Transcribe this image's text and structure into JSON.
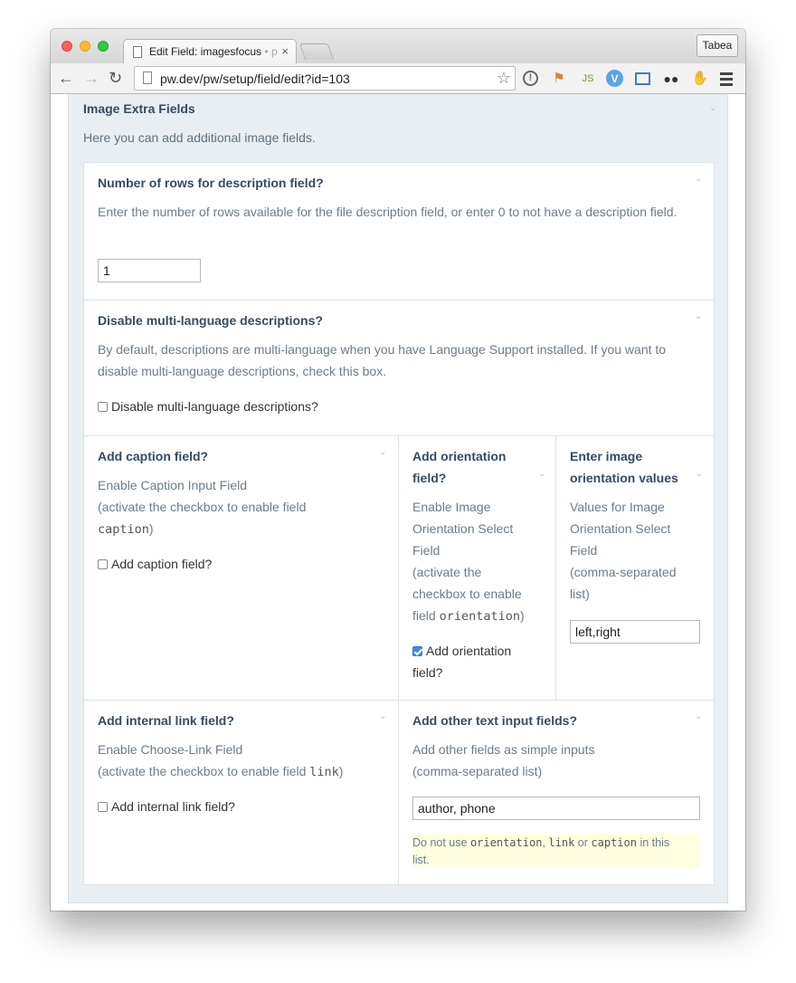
{
  "browser": {
    "tab_title": "Edit Field: imagesfocus",
    "tab_title_fade": "• p",
    "tab_close": "×",
    "user_button": "Tabea",
    "url": "pw.dev/pw/setup/field/edit?id=103",
    "icons": {
      "back": "←",
      "forward": "→",
      "reload": "↻",
      "star": "☆"
    }
  },
  "fieldset": {
    "title": "Image Extra Fields",
    "description": "Here you can add additional image fields."
  },
  "rows_field": {
    "label": "Number of rows for description field?",
    "description": "Enter the number of rows available for the file description field, or enter 0 to not have a description field.",
    "value": "1"
  },
  "multilang_field": {
    "label": "Disable multi-language descriptions?",
    "description": "By default, descriptions are multi-language when you have Language Support installed. If you want to disable multi-language descriptions, check this box.",
    "checkbox_label": "Disable multi-language descriptions?",
    "checked": false
  },
  "caption_field": {
    "label": "Add caption field?",
    "desc_line1": "Enable Caption Input Field",
    "desc_line2": "(activate the checkbox to enable field",
    "code": "caption",
    "desc_end": ")",
    "checkbox_label": "Add caption field?",
    "checked": false
  },
  "orientation_field": {
    "label_line1": "Add orientation",
    "label_line2": "field?",
    "desc_lines": [
      "Enable Image",
      "Orientation Select",
      "Field",
      "(activate the",
      "checkbox to enable"
    ],
    "desc_last_prefix": "field",
    "code": "orientation",
    "desc_end": ")",
    "checkbox_label_line1": "Add orientation",
    "checkbox_label_line2": "field?",
    "checked": true
  },
  "orientation_values": {
    "label_line1": "Enter image",
    "label_line2": "orientation values",
    "desc_lines": [
      "Values for Image",
      "Orientation Select",
      "Field",
      "(comma-separated",
      "list)"
    ],
    "value": "left,right"
  },
  "link_field": {
    "label": "Add internal link field?",
    "desc_line1": "Enable Choose-Link Field",
    "desc_line2": "(activate the checkbox to enable field",
    "code": "link",
    "desc_end": ")",
    "checkbox_label": "Add internal link field?",
    "checked": false
  },
  "other_fields": {
    "label": "Add other text input fields?",
    "desc_line1": "Add other fields as simple inputs",
    "desc_line2": "(comma-separated list)",
    "value": "author, phone",
    "note_prefix": "Do not use",
    "note_code1": "orientation",
    "note_sep1": ",",
    "note_code2": "link",
    "note_sep2": "or",
    "note_code3": "caption",
    "note_suffix": "in this",
    "note_line2": "list."
  }
}
